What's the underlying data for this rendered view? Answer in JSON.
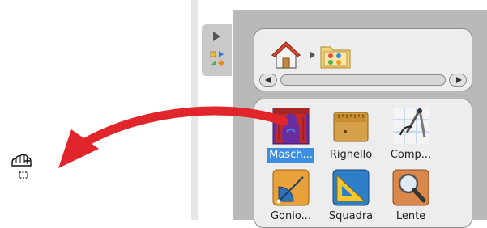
{
  "navigation": {
    "home_icon": "home-icon",
    "separator_icon": "breadcrumb-arrow-icon",
    "current_folder_icon": "tools-folder-icon"
  },
  "tools": [
    {
      "label": "Masch...",
      "icon": "theater-curtain-icon",
      "selected": true
    },
    {
      "label": "Righello",
      "icon": "ruler-icon",
      "selected": false
    },
    {
      "label": "Comp...",
      "icon": "compass-icon",
      "selected": false
    },
    {
      "label": "Gonio...",
      "icon": "protractor-icon",
      "selected": false
    },
    {
      "label": "Squadra",
      "icon": "set-square-icon",
      "selected": false
    },
    {
      "label": "Lente",
      "icon": "magnifier-icon",
      "selected": false
    }
  ],
  "colors": {
    "selection": "#3d8ee0",
    "drag_arrow": "#e0262b",
    "panel_bg": "#b9b9b9",
    "card_bg": "#ededed"
  }
}
